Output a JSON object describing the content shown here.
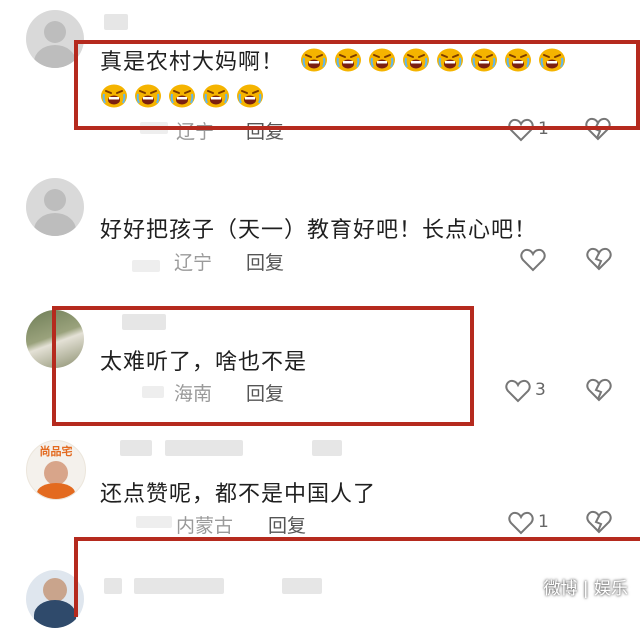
{
  "comments": [
    {
      "text": "真是农村大妈啊！",
      "emoji_count": 13,
      "location": "辽宁",
      "reply": "回复",
      "likes": "1"
    },
    {
      "text": "好好把孩子（天一）教育好吧！长点心吧！",
      "location": "辽宁",
      "reply": "回复",
      "likes": ""
    },
    {
      "text": "太难听了，啥也不是",
      "location": "海南",
      "reply": "回复",
      "likes": "3"
    },
    {
      "text": "还点赞呢，都不是中国人了",
      "location": "内蒙古",
      "reply": "回复",
      "likes": "1",
      "avatar_text": "尚品宅"
    }
  ],
  "watermark": "微博 | 娱乐",
  "colors": {
    "highlight_box": "#b52a1e",
    "emoji": "#f5b400"
  },
  "icons": {
    "like": "heart-outline-icon",
    "dislike": "broken-heart-icon",
    "emoji": "crying-face-emoji"
  }
}
